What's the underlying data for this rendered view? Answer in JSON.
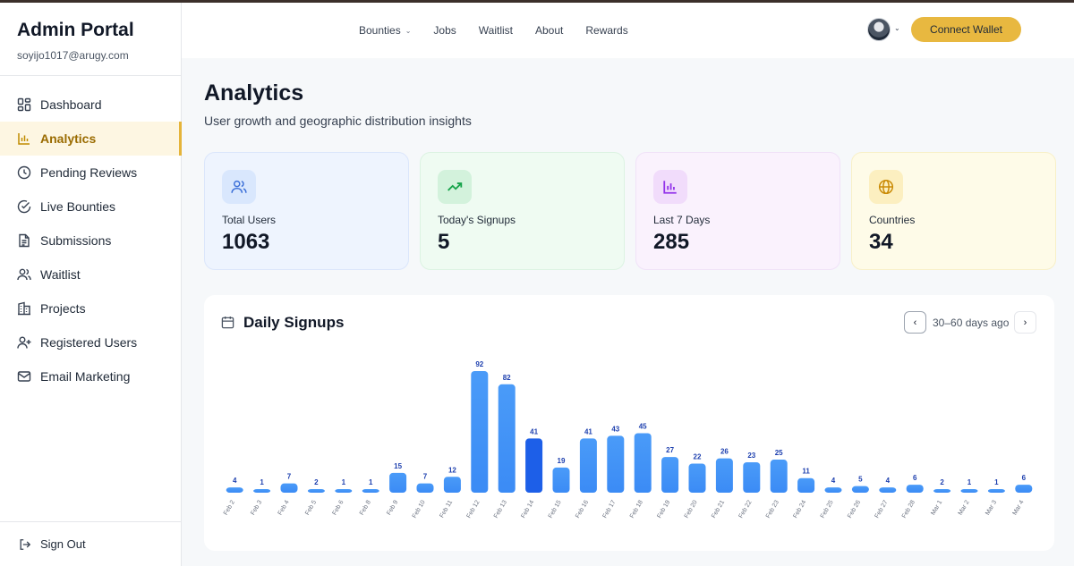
{
  "sidebar": {
    "title": "Admin Portal",
    "email": "soyijo1017@arugy.com",
    "items": [
      {
        "label": "Dashboard",
        "icon": "dashboard-icon"
      },
      {
        "label": "Analytics",
        "icon": "bar-chart-icon",
        "active": true
      },
      {
        "label": "Pending Reviews",
        "icon": "clock-icon"
      },
      {
        "label": "Live Bounties",
        "icon": "check-circle-icon"
      },
      {
        "label": "Submissions",
        "icon": "document-icon"
      },
      {
        "label": "Waitlist",
        "icon": "users-icon"
      },
      {
        "label": "Projects",
        "icon": "building-icon"
      },
      {
        "label": "Registered Users",
        "icon": "user-plus-icon"
      },
      {
        "label": "Email Marketing",
        "icon": "mail-icon"
      }
    ],
    "sign_out": "Sign Out"
  },
  "header": {
    "nav": [
      "Bounties",
      "Jobs",
      "Waitlist",
      "About",
      "Rewards"
    ],
    "connect_wallet": "Connect Wallet"
  },
  "page": {
    "title": "Analytics",
    "subtitle": "User growth and geographic distribution insights"
  },
  "stats": [
    {
      "label": "Total Users",
      "value": "1063",
      "icon": "users-icon",
      "bg": "#eef4fe",
      "border": "#dbe6fb",
      "icon_bg": "#d9e7fd",
      "icon_color": "#3b6fd8"
    },
    {
      "label": "Today's Signups",
      "value": "5",
      "icon": "trending-up-icon",
      "bg": "#effbf2",
      "border": "#dcf3e2",
      "icon_bg": "#d3f2dc",
      "icon_color": "#16a34a"
    },
    {
      "label": "Last 7 Days",
      "value": "285",
      "icon": "bar-chart-icon",
      "bg": "#faf2fd",
      "border": "#f0e2f8",
      "icon_bg": "#f1dcfb",
      "icon_color": "#9333ea"
    },
    {
      "label": "Countries",
      "value": "34",
      "icon": "globe-icon",
      "bg": "#fefbe8",
      "border": "#f8f0c8",
      "icon_bg": "#fcefc0",
      "icon_color": "#ca8a04"
    }
  ],
  "chart": {
    "title": "Daily Signups",
    "range_label": "30–60 days ago",
    "prev_symbol": "‹",
    "next_symbol": "›"
  },
  "chart_data": {
    "type": "bar",
    "categories": [
      "Feb 2",
      "Feb 3",
      "Feb 4",
      "Feb 5",
      "Feb 6",
      "Feb 8",
      "Feb 9",
      "Feb 10",
      "Feb 11",
      "Feb 12",
      "Feb 13",
      "Feb 14",
      "Feb 15",
      "Feb 16",
      "Feb 17",
      "Feb 18",
      "Feb 19",
      "Feb 20",
      "Feb 21",
      "Feb 22",
      "Feb 23",
      "Feb 24",
      "Feb 25",
      "Feb 26",
      "Feb 27",
      "Feb 28",
      "Mar 1",
      "Mar 2",
      "Mar 3",
      "Mar 4"
    ],
    "values": [
      4,
      1,
      7,
      2,
      1,
      1,
      15,
      7,
      12,
      92,
      82,
      41,
      19,
      41,
      43,
      45,
      27,
      22,
      26,
      23,
      25,
      11,
      4,
      5,
      4,
      6,
      2,
      1,
      1,
      6
    ],
    "highlight_index": 11,
    "bar_color": "#3b8bf5",
    "highlight_color": "#1d5fe8",
    "label_color": "#1e40af",
    "title": "Daily Signups",
    "grid": false
  }
}
